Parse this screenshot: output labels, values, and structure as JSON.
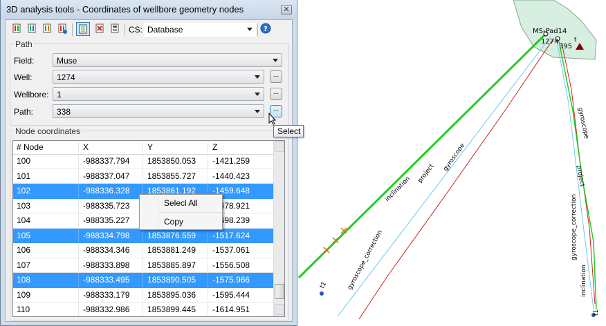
{
  "dialog": {
    "title": "3D analysis tools - Coordinates of wellbore geometry nodes",
    "close_glyph": "✕",
    "toolbar": {
      "cs_label": "CS:",
      "cs_value": "Database",
      "icons": [
        "add-well-icon",
        "add-wellbore-icon",
        "add-path-icon",
        "add-node-icon",
        "node-list-icon",
        "delete-icon",
        "export-icon",
        "help-icon"
      ]
    },
    "path_group": {
      "title": "Path",
      "field_label": "Field:",
      "field_value": "Muse",
      "well_label": "Well:",
      "well_value": "1274",
      "wellbore_label": "Wellbore:",
      "wellbore_value": "1",
      "path_label": "Path:",
      "path_value": "338",
      "browse_label": "..."
    },
    "tooltip": "Select",
    "nodes": {
      "title": "Node coordinates",
      "columns": [
        "# Node",
        "X",
        "Y",
        "Z"
      ],
      "rows": [
        {
          "node": "100",
          "x": "-988337.794",
          "y": "1853850.053",
          "z": "-1421.259",
          "selected": false
        },
        {
          "node": "101",
          "x": "-988337.047",
          "y": "1853855.727",
          "z": "-1440.423",
          "selected": false
        },
        {
          "node": "102",
          "x": "-988336.328",
          "y": "1853861.192",
          "z": "-1459.648",
          "selected": true
        },
        {
          "node": "103",
          "x": "-988335.723",
          "y": "",
          "z": "-1478.921",
          "selected": false
        },
        {
          "node": "104",
          "x": "-988335.227",
          "y": "",
          "z": "-1498.239",
          "selected": false
        },
        {
          "node": "105",
          "x": "-988334.798",
          "y": "1853876.559",
          "z": "-1517.624",
          "selected": true
        },
        {
          "node": "106",
          "x": "-988334.346",
          "y": "1853881.249",
          "z": "-1537.061",
          "selected": false
        },
        {
          "node": "107",
          "x": "-988333.898",
          "y": "1853885.897",
          "z": "-1556.508",
          "selected": false
        },
        {
          "node": "108",
          "x": "-988333.495",
          "y": "1853890.505",
          "z": "-1575.966",
          "selected": true
        },
        {
          "node": "109",
          "x": "-988333.179",
          "y": "1853895.036",
          "z": "-1595.444",
          "selected": false
        },
        {
          "node": "110",
          "x": "-988332.986",
          "y": "1853899.445",
          "z": "-1614.951",
          "selected": false
        }
      ]
    },
    "context_menu": {
      "select_all": "Selecl All",
      "copy": "Copy"
    }
  },
  "map": {
    "pad_label": "MS-Pad14",
    "well_label": "1274",
    "target_label": "395",
    "t_label": "t",
    "end_labels": [
      "t1",
      "t1"
    ],
    "left_line_labels": [
      "inclination",
      "project",
      "gyroscope",
      "gyroscope_correction"
    ],
    "right_line_labels": [
      "gyroscope",
      "project",
      "gyroscope_correction",
      "inclination"
    ]
  },
  "colors": {
    "selection": "#3399ff",
    "pad_fill": "#d6efe1",
    "inclination": "#22cc22",
    "project": "#66ccee",
    "gyroscope": "#cc2222",
    "gyroscope_correction": "#cc2222",
    "target_marker": "#880000"
  }
}
